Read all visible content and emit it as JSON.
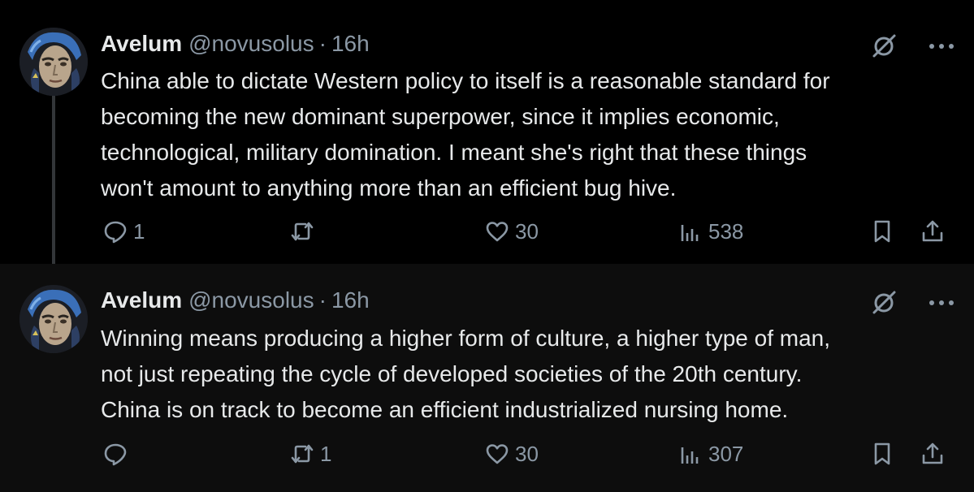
{
  "tweets": [
    {
      "name": "Avelum",
      "handle": "@novusolus",
      "separator": "·",
      "time": "16h",
      "text_lines": [
        "China able to dictate Western policy to itself is a reasonable standard for",
        "becoming the new dominant superpower, since it implies economic,",
        "technological, military domination. I meant she's right that these things",
        "won't amount to anything more than an efficient bug hive."
      ],
      "stats": {
        "replies": "1",
        "reposts": "",
        "likes": "30",
        "views": "538"
      }
    },
    {
      "name": "Avelum",
      "handle": "@novusolus",
      "separator": "·",
      "time": "16h",
      "text_lines": [
        "Winning means producing a higher form of culture, a higher type of man,",
        "not just repeating the cycle of developed societies of the 20th century.",
        "China is on track to become an efficient industrialized nursing home."
      ],
      "stats": {
        "replies": "",
        "reposts": "1",
        "likes": "30",
        "views": "307"
      }
    }
  ],
  "icons": {
    "avatar": "avatar-portrait",
    "grok": "grok-icon",
    "more": "more-icon",
    "reply": "reply-icon",
    "repost": "repost-icon",
    "like": "heart-icon",
    "views": "views-icon",
    "bookmark": "bookmark-icon",
    "share": "share-icon"
  },
  "colors": {
    "background": "#000000",
    "background_alt": "#0d0d0d",
    "text": "#e7e9ea",
    "muted": "#8b98a5"
  }
}
